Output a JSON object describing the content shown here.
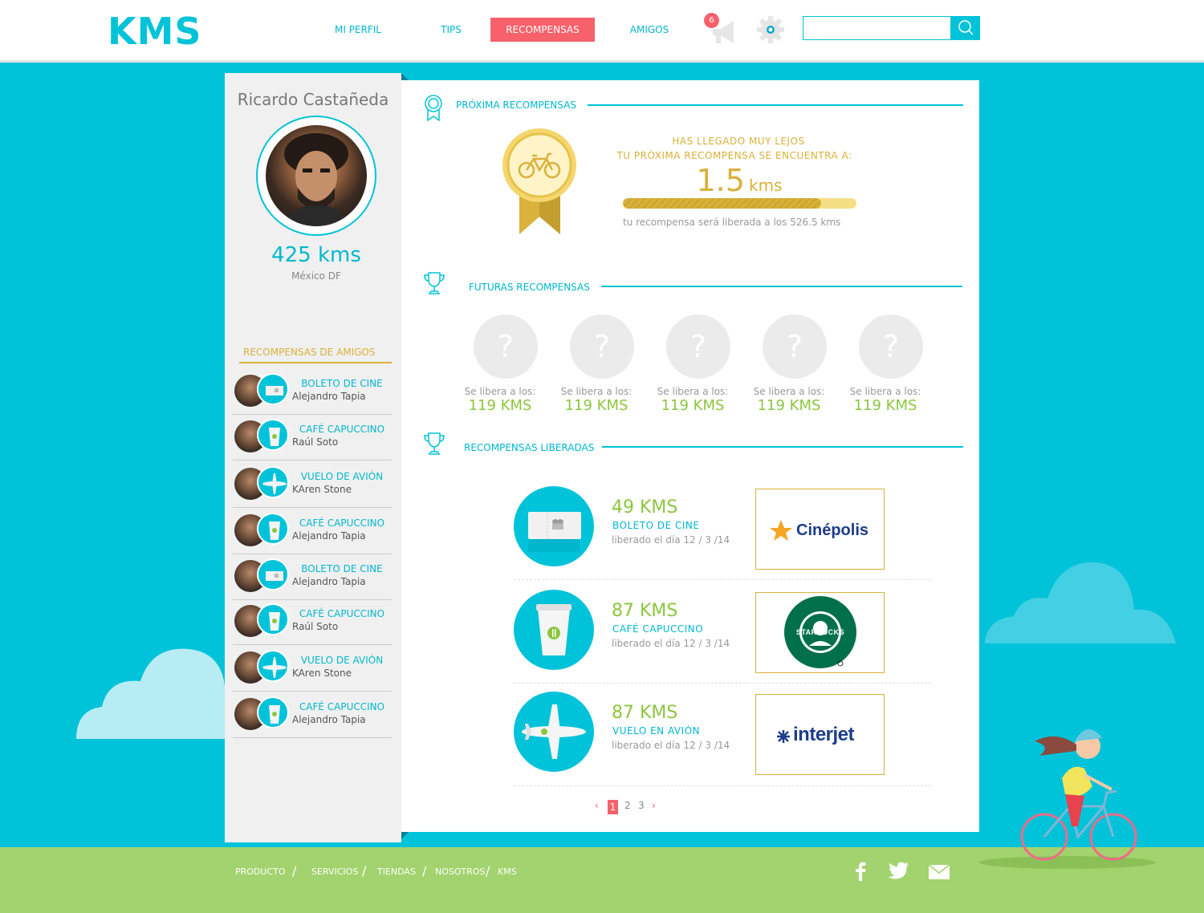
{
  "header": {
    "logo": "KMS",
    "nav": [
      {
        "label": "MI PERFIL",
        "active": false
      },
      {
        "label": "TIPS",
        "active": false
      },
      {
        "label": "RECOMPENSAS",
        "active": true
      },
      {
        "label": "AMIGOS",
        "active": false
      }
    ],
    "notifications_count": "6",
    "search": {
      "value": "",
      "placeholder": ""
    }
  },
  "profile": {
    "name": "Ricardo Castañeda",
    "total_kms": "425 kms",
    "city": "México DF"
  },
  "friends_rewards": {
    "title": "RECOMPENSAS  DE AMIGOS",
    "items": [
      {
        "reward": "BOLETO DE CINE",
        "friend": "Alejandro Tapia",
        "icon": "ticket-icon"
      },
      {
        "reward": "CAFÉ CAPUCCINO",
        "friend": "Raúl Soto",
        "icon": "coffee-cup-icon"
      },
      {
        "reward": "VUELO DE AVIÓN",
        "friend": "KAren Stone",
        "icon": "airplane-icon"
      },
      {
        "reward": "CAFÉ CAPUCCINO",
        "friend": "Alejandro Tapia",
        "icon": "coffee-cup-icon"
      },
      {
        "reward": "BOLETO DE CINE",
        "friend": "Alejandro Tapia",
        "icon": "ticket-icon"
      },
      {
        "reward": "CAFÉ CAPUCCINO",
        "friend": "Raúl Soto",
        "icon": "coffee-cup-icon"
      },
      {
        "reward": "VUELO DE AVIÓN",
        "friend": "KAren Stone",
        "icon": "airplane-icon"
      },
      {
        "reward": "CAFÉ CAPUCCINO",
        "friend": "Alejandro Tapia",
        "icon": "coffee-cup-icon"
      }
    ]
  },
  "next_reward": {
    "section_title": "PRÓXIMA RECOMPENSAS",
    "line1": "HAS LLEGADO MUY LEJOS",
    "line2": "TU PRÓXIMA RECOMPENSA SE ENCUENTRA A:",
    "distance_value": "1.5",
    "distance_unit": "kms",
    "progress_fraction": 0.85,
    "release_note": "tu recompensa será liberada a los 526.5 kms",
    "medal_icon": "bicycle-icon"
  },
  "future_rewards": {
    "section_title": "FUTURAS RECOMPENSAS",
    "items": [
      {
        "mark": "?",
        "label": "Se libera a los:",
        "value": "119 KMS"
      },
      {
        "mark": "?",
        "label": "Se libera a los:",
        "value": "119 KMS"
      },
      {
        "mark": "?",
        "label": "Se libera a los:",
        "value": "119 KMS"
      },
      {
        "mark": "?",
        "label": "Se libera a los:",
        "value": "119 KMS"
      },
      {
        "mark": "?",
        "label": "Se libera a los:",
        "value": "119 KMS"
      }
    ]
  },
  "unlocked_rewards": {
    "section_title": "RECOMPENSAS LIBERADAS",
    "items": [
      {
        "kms": "49 KMS",
        "name": "BOLETO DE CINE",
        "date": "liberado el día 12 / 3 /14",
        "brand": "Cinépolis",
        "icon": "ticket-icon"
      },
      {
        "kms": "87 KMS",
        "name": "CAFÉ CAPUCCINO",
        "date": "liberado el día 12 / 3 /14",
        "brand": "STARBUCKS COFFEE",
        "icon": "coffee-cup-icon"
      },
      {
        "kms": "87 KMS",
        "name": "VUELO EN AVIÓN",
        "date": "liberado el día 12 / 3 /14",
        "brand": "interjet",
        "icon": "airplane-icon"
      }
    ]
  },
  "pagination": {
    "prev": "‹",
    "pages": [
      "1",
      "2",
      "3"
    ],
    "current": "1",
    "next": "›"
  },
  "footer": {
    "links": [
      "PRODUCTO",
      "SERVICIOS",
      "TIENDAS",
      "NOSOTROS",
      "KMS"
    ],
    "separator": "/",
    "social": [
      "facebook-icon",
      "twitter-icon",
      "mail-icon"
    ]
  },
  "colors": {
    "accent": "#00c3da",
    "active_nav": "#f7616b",
    "gold": "#d9b13b",
    "green": "#8cc63f",
    "ground": "#a3d36e"
  }
}
